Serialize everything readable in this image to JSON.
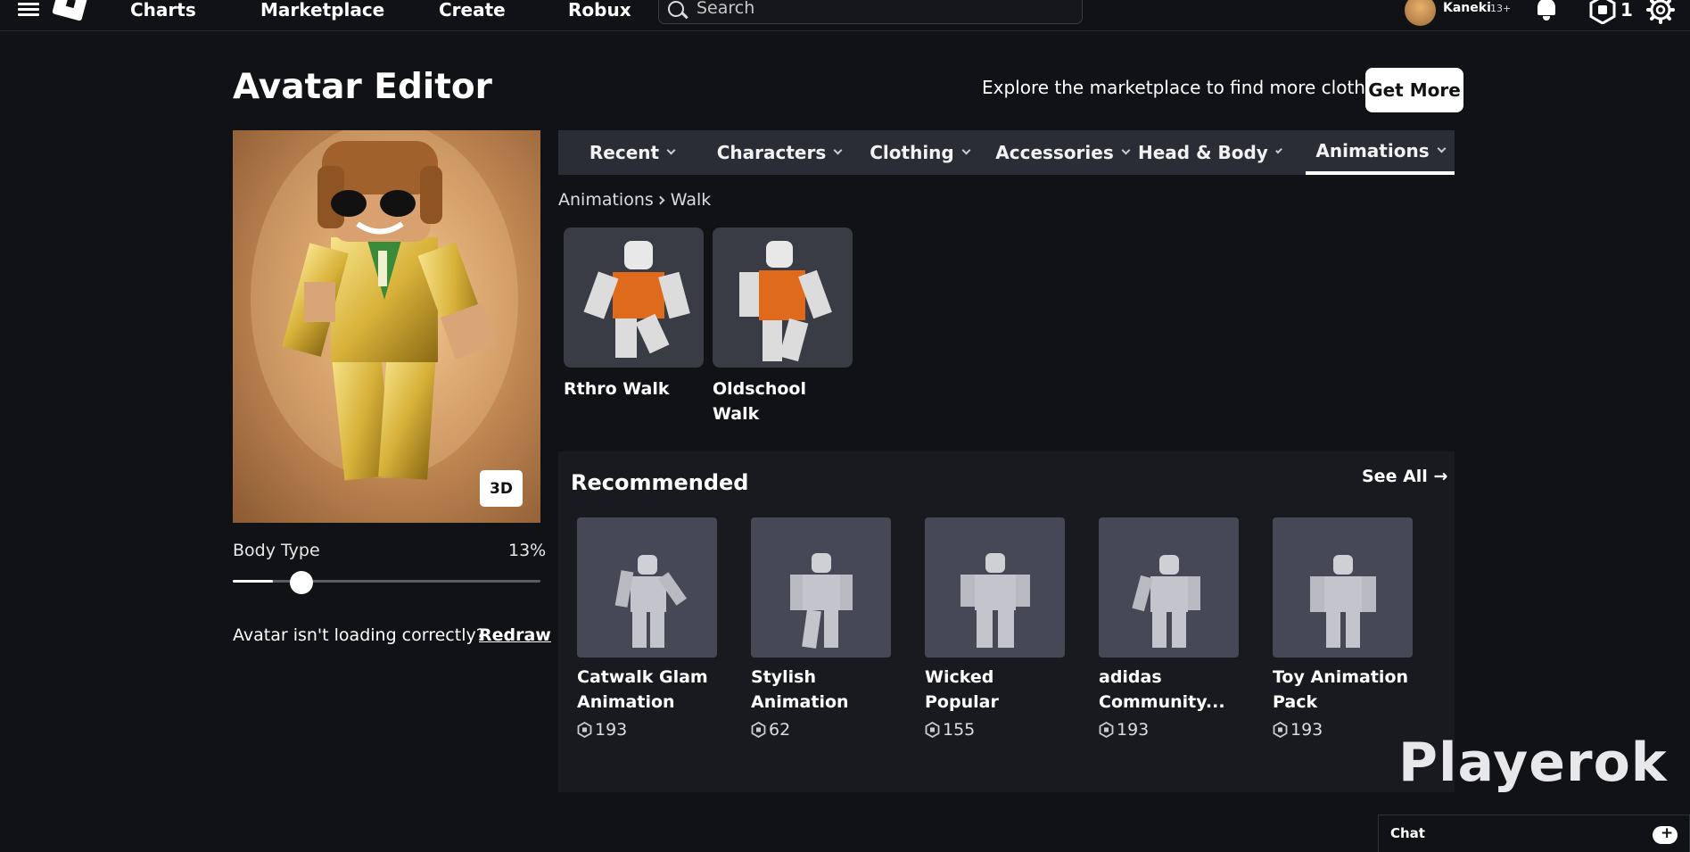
{
  "nav": {
    "links": [
      "Charts",
      "Marketplace",
      "Create",
      "Robux"
    ],
    "search_placeholder": "Search",
    "user_name": "Kaneki",
    "user_age": "13+",
    "robux_count": "1"
  },
  "header": {
    "title": "Avatar Editor",
    "explore_text": "Explore the marketplace to find more clothes!",
    "get_more_label": "Get More"
  },
  "avatar": {
    "view_mode_label": "3D",
    "body_type_label": "Body Type",
    "body_type_value": "13%",
    "body_type_level": 0.13,
    "loading_text": "Avatar isn't loading correctly?",
    "redraw_label": "Redraw"
  },
  "tabs": [
    {
      "label": "Recent",
      "active": false
    },
    {
      "label": "Characters",
      "active": false
    },
    {
      "label": "Clothing",
      "active": false
    },
    {
      "label": "Accessories",
      "active": false
    },
    {
      "label": "Head & Body",
      "active": false
    },
    {
      "label": "Animations",
      "active": true
    }
  ],
  "breadcrumb": {
    "parent": "Animations",
    "current": "Walk"
  },
  "items": [
    {
      "name": "Rthro Walk"
    },
    {
      "name": "Oldschool Walk"
    }
  ],
  "recommended": {
    "title": "Recommended",
    "see_all_label": "See All",
    "items": [
      {
        "name": "Catwalk Glam Animation Pac...",
        "price": "193"
      },
      {
        "name": "Stylish Animation Pack",
        "price": "62"
      },
      {
        "name": "Wicked Popular Animation Pack",
        "price": "155"
      },
      {
        "name": "adidas Community...",
        "price": "193"
      },
      {
        "name": "Toy Animation Pack",
        "price": "193"
      }
    ]
  },
  "watermark": "Playerok",
  "chat": {
    "label": "Chat"
  },
  "colors": {
    "background": "#111216",
    "tab_bar": "#2a2d35",
    "panel": "#191a20",
    "thumb": "#393b45"
  }
}
